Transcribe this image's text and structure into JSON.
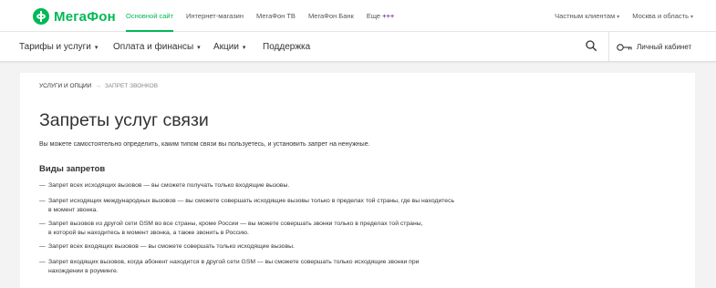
{
  "logo": {
    "text": "МегаФон"
  },
  "top_nav": [
    {
      "label": "Основной сайт",
      "active": true
    },
    {
      "label": "Интернет-магазин",
      "active": false
    },
    {
      "label": "МегаФон ТВ",
      "active": false
    },
    {
      "label": "МегаФон Банк",
      "active": false
    },
    {
      "label": "Еще",
      "suffix": "+++",
      "active": false
    }
  ],
  "top_right": {
    "segment": "Частным клиентам",
    "region": "Москва и область"
  },
  "main_nav": [
    {
      "label": "Тарифы и услуги"
    },
    {
      "label": "Оплата и финансы"
    },
    {
      "label": "Акции"
    },
    {
      "label": "Поддержка"
    }
  ],
  "account": {
    "label": "Личный кабинет"
  },
  "breadcrumb": {
    "link": "УСЛУГИ И ОПЦИИ",
    "separator": "→",
    "current": "ЗАПРЕТ ЗВОНКОВ"
  },
  "page": {
    "title": "Запреты услуг связи",
    "intro": "Вы можете самостоятельно определить, каким типом связи вы пользуетесь, и установить запрет на ненужные.",
    "section_title": "Виды запретов",
    "items": [
      {
        "line1": "Запрет всех исходящих вызовов — вы сможете получать только входящие вызовы.",
        "line2": ""
      },
      {
        "line1": "Запрет исходящих международных вызовов — вы сможете совершать исходящие вызовы только в пределах той страны, где вы находитесь",
        "line2": "в момент звонка."
      },
      {
        "line1": "Запрет вызовов из другой сети GSM во все страны, кроме России — вы можете совершать звонки только в пределах той страны,",
        "line2": "в которой вы находитесь в момент звонка, а также звонить в Россию."
      },
      {
        "line1": "Запрет всех входящих вызовов — вы сможете совершать только исходящие вызовы.",
        "line2": ""
      },
      {
        "line1": "Запрет входящих вызовов, когда абонент находится в другой сети GSM — вы сможете совершать только исходящие звонки при",
        "line2": "нахождении в роуминге."
      }
    ]
  },
  "colors": {
    "brand_green": "#00b956",
    "brand_purple": "#7b3fa0"
  }
}
